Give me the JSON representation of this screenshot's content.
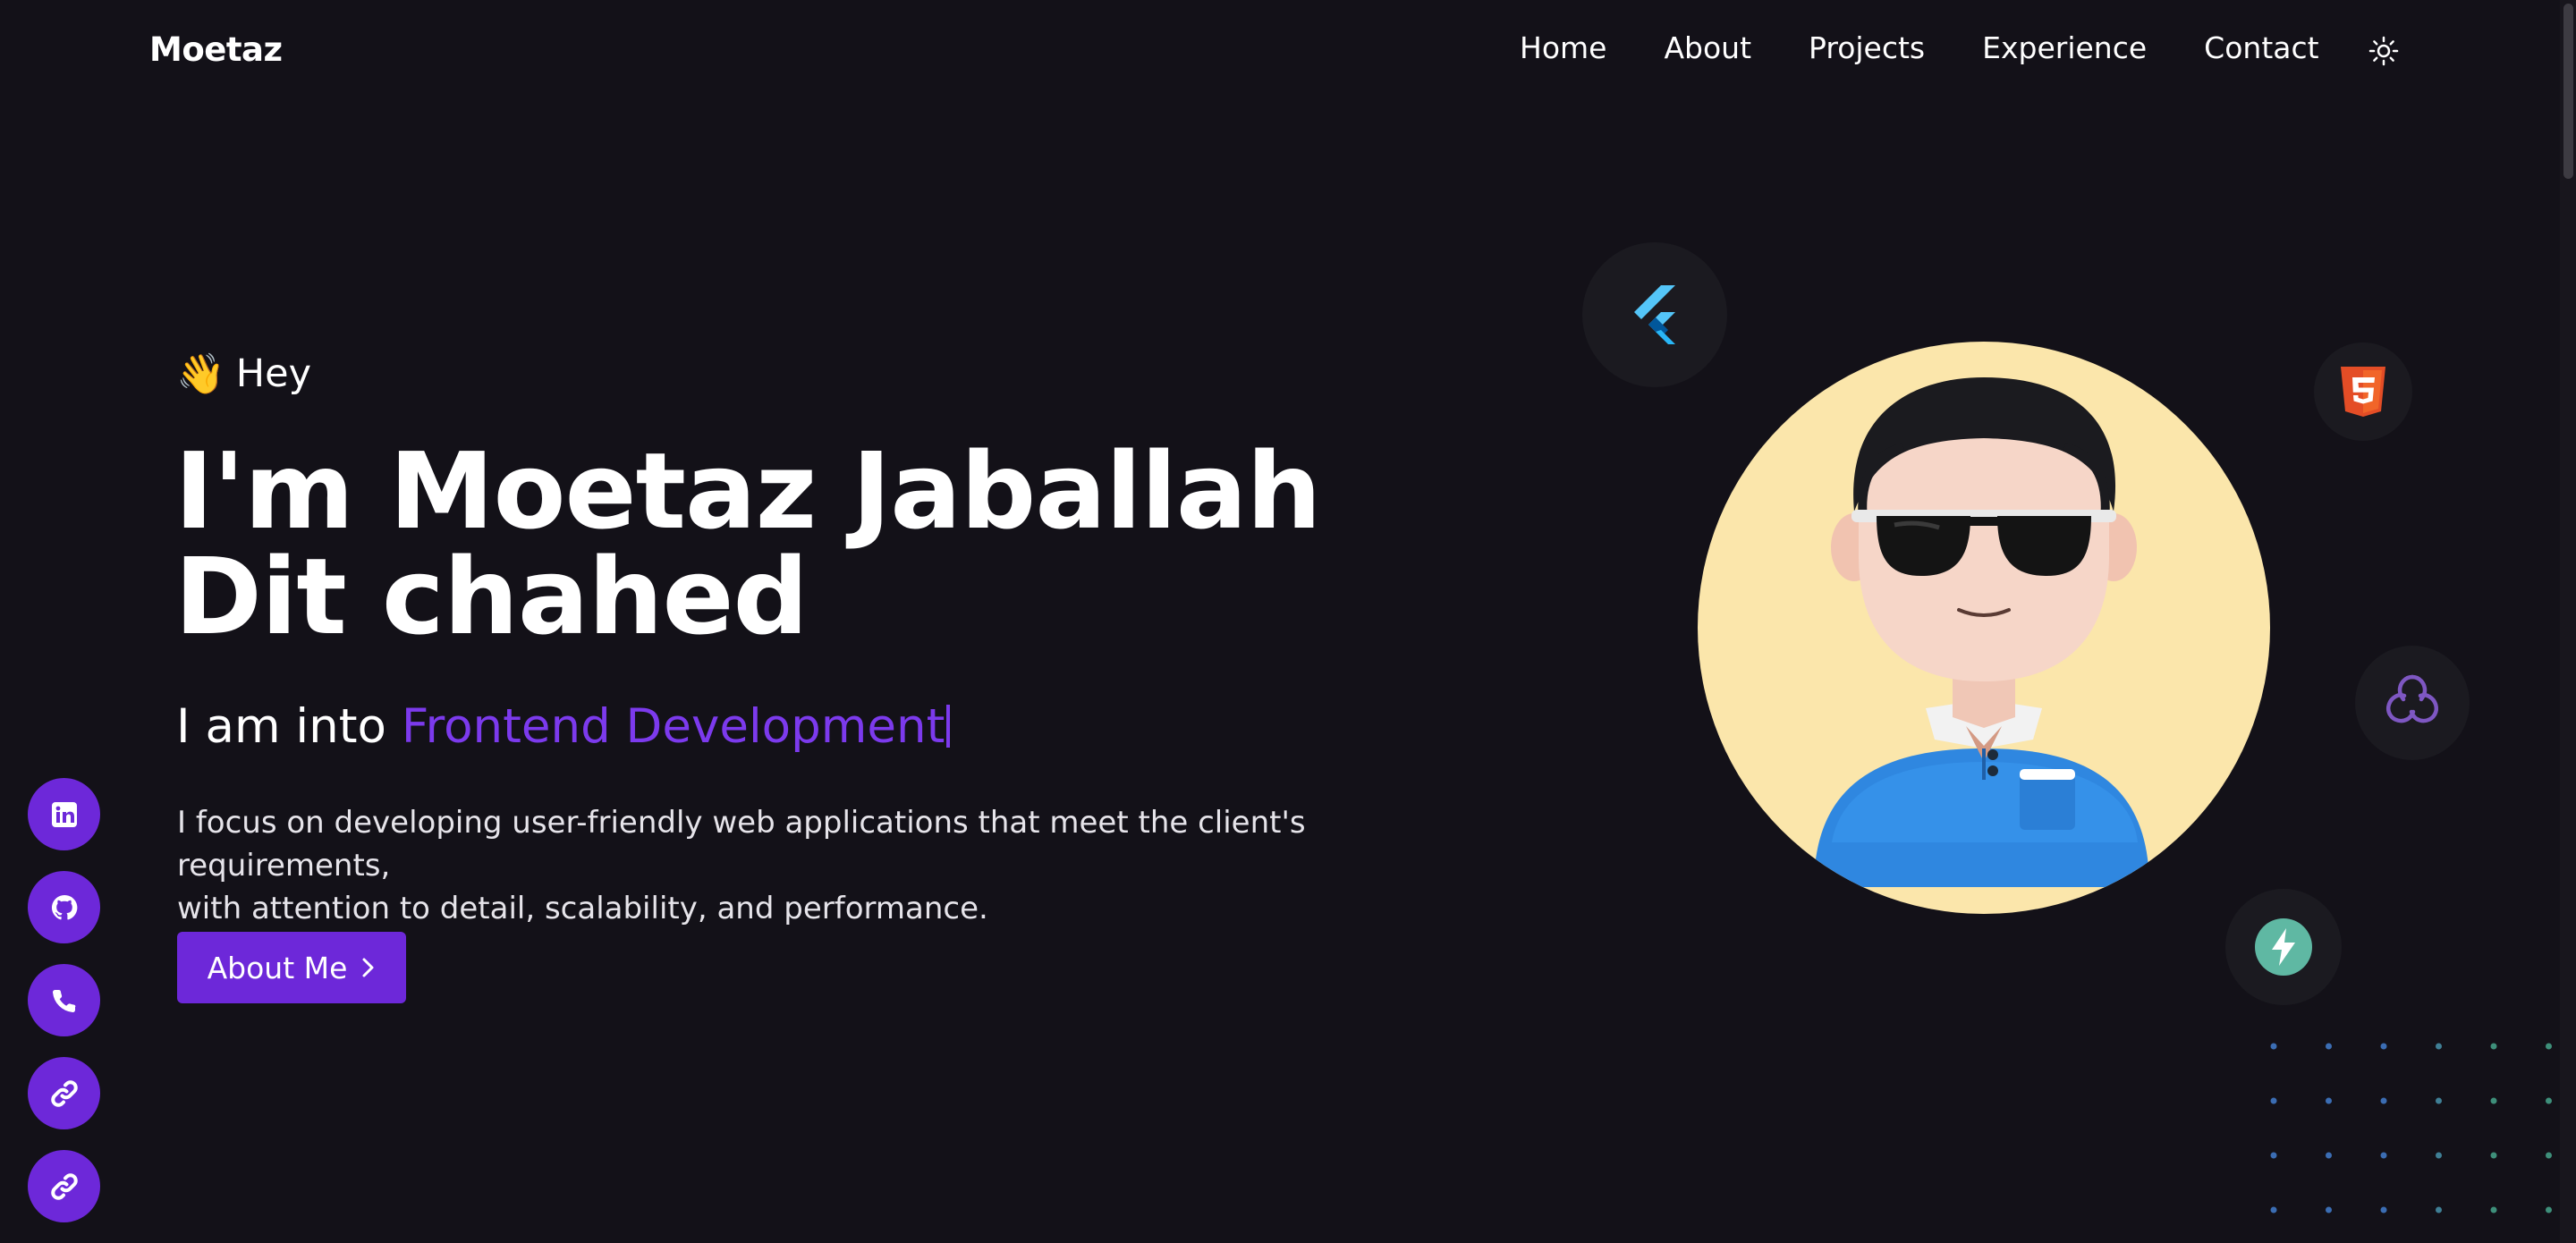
{
  "nav": {
    "brand": "Moetaz",
    "links": [
      "Home",
      "About",
      "Projects",
      "Experience",
      "Contact"
    ]
  },
  "hero": {
    "greeting": "Hey",
    "headline_line1": "I'm Moetaz Jaballah",
    "headline_line2": "Dit chahed",
    "sub_prefix": "I am into ",
    "sub_accent": "Frontend Development",
    "description_line1": "I focus on developing user-friendly web applications that meet the client's requirements,",
    "description_line2": "with attention to detail, scalability, and performance.",
    "cta_label": "About Me"
  },
  "social": [
    "linkedin-icon",
    "github-icon",
    "phone-icon",
    "link-icon",
    "link-icon"
  ],
  "tech_icons": [
    "flutter-icon",
    "html5-icon",
    "react-query-icon",
    "supabase-icon"
  ],
  "colors": {
    "background": "#131118",
    "accent": "#7c3aed",
    "button": "#6d28d9",
    "avatar_bg": "#fbe6ab"
  }
}
